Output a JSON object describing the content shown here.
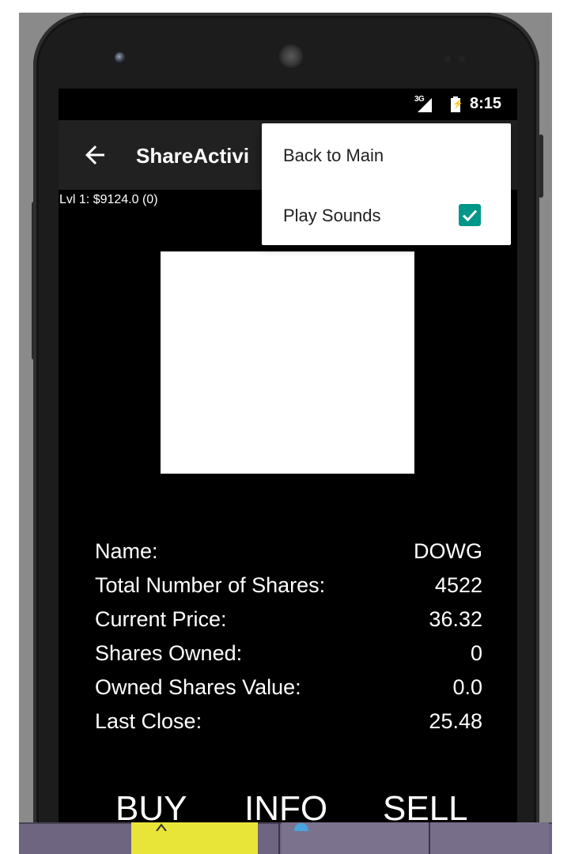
{
  "status_bar": {
    "network_type": "3G",
    "time": "8:15",
    "icons": [
      "cell-signal-icon",
      "battery-charging-icon"
    ]
  },
  "app_bar": {
    "back_icon": "arrow-back-icon",
    "title": "ShareActivi"
  },
  "level_label": "Lvl 1: $9124.0 (0)",
  "overflow_menu": {
    "items": [
      {
        "label": "Back to Main"
      },
      {
        "label": "Play Sounds",
        "checked": true
      }
    ],
    "checkbox_color": "#009688"
  },
  "share_info": {
    "rows": [
      {
        "label": "Name:",
        "value": "DOWG"
      },
      {
        "label": "Total Number of Shares:",
        "value": "4522"
      },
      {
        "label": "Current Price:",
        "value": "36.32"
      },
      {
        "label": "Shares Owned:",
        "value": "0"
      },
      {
        "label": "Owned Shares Value:",
        "value": "0.0"
      },
      {
        "label": "Last Close:",
        "value": "25.48"
      }
    ]
  },
  "actions": {
    "buy_label": "BUY",
    "info_label": "INFO",
    "sell_label": "SELL"
  },
  "colors": {
    "app_bar": "#212121",
    "screen_background": "#000000",
    "accent": "#009688",
    "taskbar": "#6e6580",
    "taskbar_highlight": "#e9e538"
  }
}
